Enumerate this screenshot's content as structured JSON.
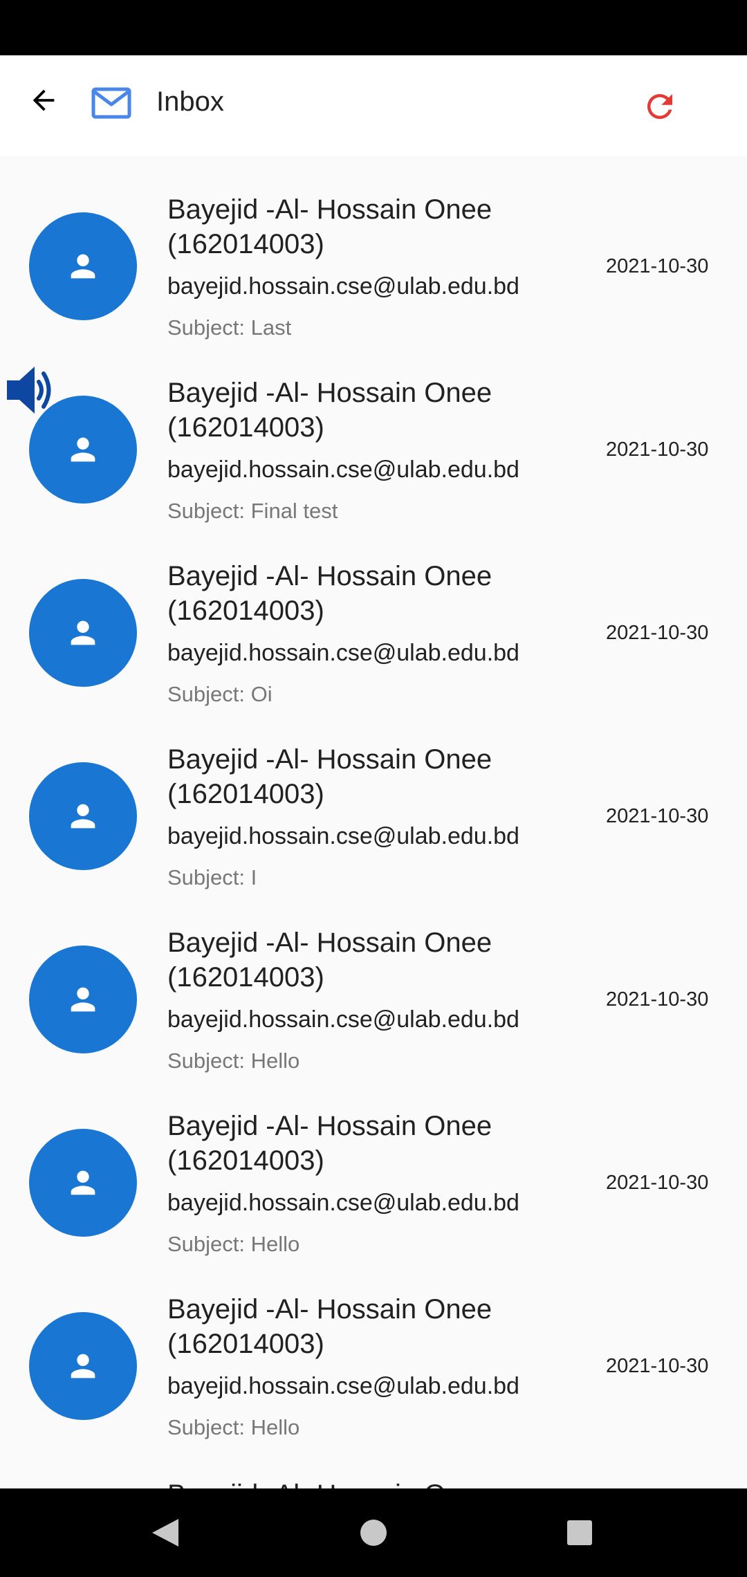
{
  "app_bar": {
    "title": "Inbox",
    "colors": {
      "mail_icon": "#4a86e8",
      "refresh_icon": "#e53935"
    }
  },
  "emails": [
    {
      "name": "Bayejid -Al- Hossain Onee (162014003)",
      "email": "bayejid.hossain.cse@ulab.edu.bd",
      "subject": "Subject: Last",
      "date": "2021-10-30"
    },
    {
      "name": "Bayejid -Al- Hossain Onee (162014003)",
      "email": "bayejid.hossain.cse@ulab.edu.bd",
      "subject": "Subject: Final test",
      "date": "2021-10-30"
    },
    {
      "name": "Bayejid -Al- Hossain Onee (162014003)",
      "email": "bayejid.hossain.cse@ulab.edu.bd",
      "subject": "Subject: Oi",
      "date": "2021-10-30"
    },
    {
      "name": "Bayejid -Al- Hossain Onee (162014003)",
      "email": "bayejid.hossain.cse@ulab.edu.bd",
      "subject": "Subject: I",
      "date": "2021-10-30"
    },
    {
      "name": "Bayejid -Al- Hossain Onee (162014003)",
      "email": "bayejid.hossain.cse@ulab.edu.bd",
      "subject": "Subject: Hello",
      "date": "2021-10-30"
    },
    {
      "name": "Bayejid -Al- Hossain Onee (162014003)",
      "email": "bayejid.hossain.cse@ulab.edu.bd",
      "subject": "Subject: Hello",
      "date": "2021-10-30"
    },
    {
      "name": "Bayejid -Al- Hossain Onee (162014003)",
      "email": "bayejid.hossain.cse@ulab.edu.bd",
      "subject": "Subject: Hello",
      "date": "2021-10-30"
    }
  ],
  "partial_item": {
    "name": "Bayejid -Al- Hossain Onee"
  },
  "colors": {
    "avatar": "#1976d2",
    "speaker_icon": "#0d47a1"
  },
  "icons": {
    "back": "arrow-back-icon",
    "mail": "mail-icon",
    "refresh": "refresh-icon",
    "avatar": "person-icon",
    "speaker": "volume-icon",
    "nav_back": "triangle-back-icon",
    "nav_home": "circle-home-icon",
    "nav_recents": "square-recents-icon"
  }
}
